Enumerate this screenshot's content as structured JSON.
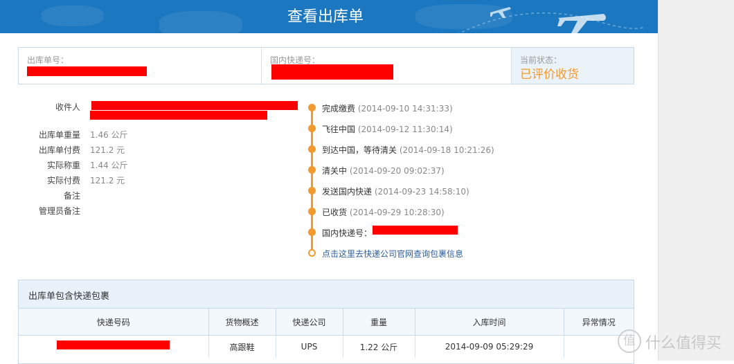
{
  "header": {
    "title": "查看出库单"
  },
  "summary": {
    "order_no_label": "出库单号：",
    "domestic_no_label": "国内快递号：",
    "status_label": "当前状态：",
    "status_value": "已评价收货",
    "status_color": "#f39a2e"
  },
  "info": {
    "rows": [
      {
        "key": "收件人",
        "value": ""
      },
      {
        "key": "出库单重量",
        "value": "1.46 公斤"
      },
      {
        "key": "出库单付费",
        "value": "121.2 元"
      },
      {
        "key": "实际称重",
        "value": "1.44 公斤"
      },
      {
        "key": "实际付费",
        "value": "121.2 元"
      },
      {
        "key": "备注",
        "value": ""
      },
      {
        "key": "管理员备注",
        "value": ""
      }
    ]
  },
  "timeline": {
    "items": [
      {
        "label": "完成缴费",
        "time": "(2014-09-10 14:31:33)"
      },
      {
        "label": "飞往中国",
        "time": "(2014-09-12 11:30:14)"
      },
      {
        "label": "到达中国，等待清关",
        "time": "(2014-09-18 10:21:26)"
      },
      {
        "label": "清关中",
        "time": "(2014-09-20 09:02:37)"
      },
      {
        "label": "发送国内快递",
        "time": "(2014-09-23 14:58:10)"
      },
      {
        "label": "已收货",
        "time": "(2014-09-29 10:28:30)"
      },
      {
        "label": "国内快递号：",
        "time": ""
      }
    ],
    "link": "点击这里去快递公司官网查询包裹信息"
  },
  "packages": {
    "title": "出库单包含快递包裹",
    "columns": [
      "快递号码",
      "货物概述",
      "快递公司",
      "重量",
      "入库时间",
      "异常情况"
    ],
    "rows": [
      {
        "tracking": "",
        "desc": "高跟鞋",
        "carrier": "UPS",
        "weight": "1.22 公斤",
        "time": "2014-09-09 05:29:29",
        "exception": ""
      }
    ]
  },
  "watermark": {
    "text": "什么值得买",
    "icon": "值"
  }
}
